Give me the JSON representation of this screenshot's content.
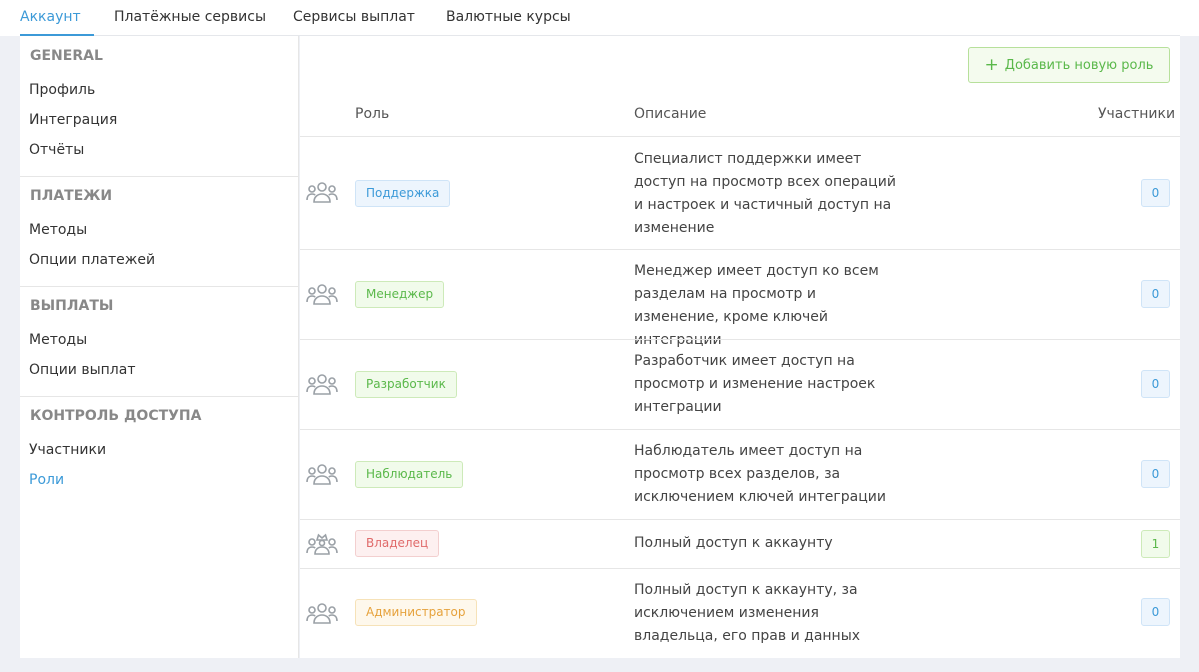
{
  "tabs": [
    {
      "label": "Аккаунт",
      "active": true
    },
    {
      "label": "Платёжные сервисы",
      "active": false
    },
    {
      "label": "Сервисы выплат",
      "active": false
    },
    {
      "label": "Валютные курсы",
      "active": false
    }
  ],
  "sidebar": {
    "sections": [
      {
        "header": "GENERAL",
        "items": [
          "Профиль",
          "Интеграция",
          "Отчёты"
        ]
      },
      {
        "header": "ПЛАТЕЖИ",
        "items": [
          "Методы",
          "Опции платежей"
        ]
      },
      {
        "header": "ВЫПЛАТЫ",
        "items": [
          "Методы",
          "Опции выплат"
        ]
      },
      {
        "header": "КОНТРОЛЬ ДОСТУПА",
        "items": [
          "Участники",
          "Роли"
        ]
      }
    ],
    "active_item": "Роли"
  },
  "main": {
    "add_button": {
      "icon": "plus-icon",
      "label": "Добавить новую роль"
    },
    "columns": {
      "role": "Роль",
      "description": "Описание",
      "members": "Участники"
    },
    "rows": [
      {
        "icon": "users-group-icon",
        "role": "Поддержка",
        "color": "blue",
        "description": "Специалист поддержки имеет доступ на просмотр всех операций и настроек и частичный доступ на изменение",
        "members": "0",
        "count_color": "blue"
      },
      {
        "icon": "users-group-icon",
        "role": "Менеджер",
        "color": "green",
        "description": "Менеджер имеет доступ ко всем разделам на просмотр и изменение, кроме ключей интеграции",
        "members": "0",
        "count_color": "blue"
      },
      {
        "icon": "users-group-icon",
        "role": "Разработчик",
        "color": "green",
        "description": "Разработчик имеет доступ на просмотр и изменение настроек интеграции",
        "members": "0",
        "count_color": "blue"
      },
      {
        "icon": "users-group-icon",
        "role": "Наблюдатель",
        "color": "green",
        "description": "Наблюдатель имеет доступ на просмотр всех разделов, за исключением ключей интеграции",
        "members": "0",
        "count_color": "blue"
      },
      {
        "icon": "users-crown-icon",
        "role": "Владелец",
        "color": "red",
        "description": "Полный доступ к аккаунту",
        "members": "1",
        "count_color": "green"
      },
      {
        "icon": "users-group-icon",
        "role": "Администратор",
        "color": "orange",
        "description": "Полный доступ к аккаунту, за исключением изменения владельца, его прав и данных",
        "members": "0",
        "count_color": "blue"
      }
    ]
  },
  "colors": {
    "accent": "#3c9ad8",
    "success": "#5ab84a",
    "danger": "#e06a6a",
    "warning": "#e6a23c"
  }
}
